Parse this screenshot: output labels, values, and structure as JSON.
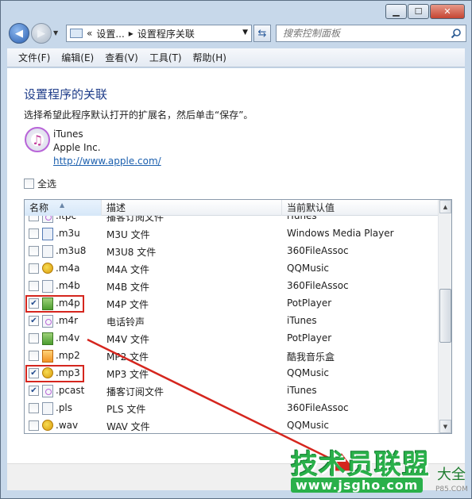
{
  "window": {
    "caption": {
      "minimize": "▁",
      "maximize": "☐",
      "close": "✕"
    }
  },
  "address": {
    "prefix": "«",
    "crumb1": "设置...",
    "sep": "▸",
    "crumb2": "设置程序关联"
  },
  "search": {
    "placeholder": "搜索控制面板"
  },
  "menu": [
    "文件(F)",
    "编辑(E)",
    "查看(V)",
    "工具(T)",
    "帮助(H)"
  ],
  "page": {
    "title": "设置程序的关联",
    "instructions": "选择希望此程序默认打开的扩展名，然后单击“保存”。",
    "app": {
      "name": "iTunes",
      "vendor": "Apple Inc.",
      "url": "http://www.apple.com/"
    },
    "select_all": "全选"
  },
  "list": {
    "columns": [
      "名称",
      "描述",
      "当前默认值"
    ],
    "rows": [
      {
        "ext": ".itpc",
        "desc": "播客订阅文件",
        "default": "iTunes",
        "checked": false,
        "icon": "itunes-file-icon"
      },
      {
        "ext": ".m3u",
        "desc": "M3U 文件",
        "default": "Windows Media Player",
        "checked": false,
        "icon": "wmp-file-icon"
      },
      {
        "ext": ".m3u8",
        "desc": "M3U8 文件",
        "default": "360FileAssoc",
        "checked": false,
        "icon": "generic-file-icon"
      },
      {
        "ext": ".m4a",
        "desc": "M4A 文件",
        "default": "QQMusic",
        "checked": false,
        "icon": "qqmusic-icon"
      },
      {
        "ext": ".m4b",
        "desc": "M4B 文件",
        "default": "360FileAssoc",
        "checked": false,
        "icon": "generic-file-icon"
      },
      {
        "ext": ".m4p",
        "desc": "M4P 文件",
        "default": "PotPlayer",
        "checked": true,
        "icon": "potplayer-icon"
      },
      {
        "ext": ".m4r",
        "desc": "电话铃声",
        "default": "iTunes",
        "checked": true,
        "icon": "itunes-file-icon"
      },
      {
        "ext": ".m4v",
        "desc": "M4V 文件",
        "default": "PotPlayer",
        "checked": false,
        "icon": "potplayer-icon"
      },
      {
        "ext": ".mp2",
        "desc": "MP2 文件",
        "default": "酷我音乐盒",
        "checked": false,
        "icon": "kuwo-icon"
      },
      {
        "ext": ".mp3",
        "desc": "MP3 文件",
        "default": "QQMusic",
        "checked": true,
        "icon": "qqmusic-icon"
      },
      {
        "ext": ".pcast",
        "desc": "播客订阅文件",
        "default": "iTunes",
        "checked": true,
        "icon": "itunes-file-icon"
      },
      {
        "ext": ".pls",
        "desc": "PLS 文件",
        "default": "360FileAssoc",
        "checked": false,
        "icon": "generic-file-icon"
      },
      {
        "ext": ".wav",
        "desc": "WAV 文件",
        "default": "QQMusic",
        "checked": false,
        "icon": "qqmusic-icon"
      }
    ]
  },
  "watermark": {
    "title": "技术员联盟",
    "suffix": "大全",
    "url": "www.jsgho.com",
    "p85": "P85.COM"
  },
  "colors": {
    "highlight": "#d5261e",
    "link": "#1b5fae",
    "title": "#1f3d8a"
  }
}
